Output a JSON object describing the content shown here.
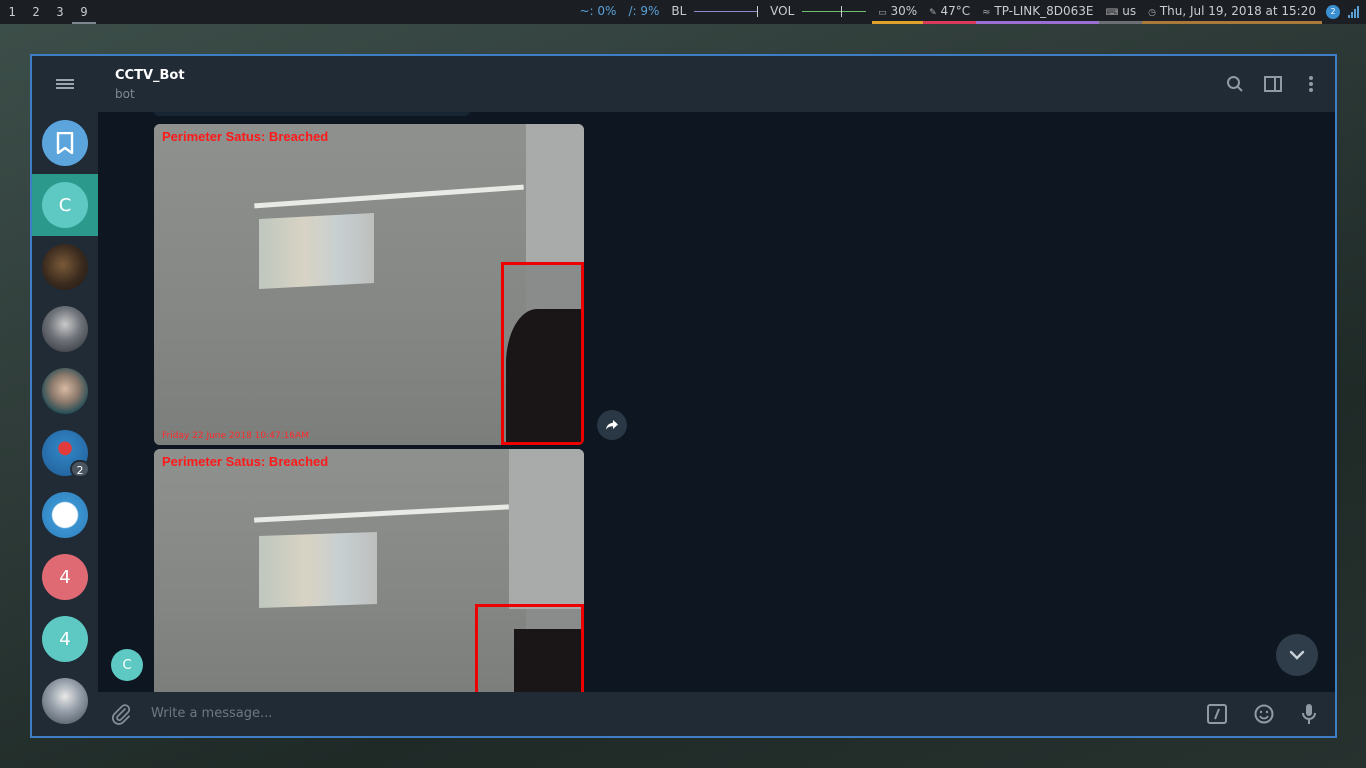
{
  "topbar": {
    "workspaces": [
      {
        "label": "1"
      },
      {
        "label": "2"
      },
      {
        "label": "3"
      },
      {
        "label": "9"
      }
    ],
    "active_workspace": "9",
    "home_usage_label": "~: 0%",
    "root_usage_label": "/: 9%",
    "backlight_label": "BL",
    "backlight_level": 1.0,
    "volume_label": "VOL",
    "volume_level": 0.6,
    "battery_label": "30%",
    "temperature_label": "47°C",
    "wifi_label": "TP-LINK_8D063E",
    "keyboard_layout": "us",
    "datetime": "Thu, Jul 19, 2018 at 15:20",
    "tray_badge": "2"
  },
  "sidebar": {
    "chats": [
      {
        "type": "saved",
        "icon": "bookmark-icon",
        "color": "#5ba4dc"
      },
      {
        "type": "initial",
        "initial": "C",
        "color": "#5ec9c3",
        "active": true
      },
      {
        "type": "photo",
        "color": "#4a3a2c"
      },
      {
        "type": "photo",
        "color": "#51565c"
      },
      {
        "type": "photo",
        "color": "#2f5e66"
      },
      {
        "type": "photo",
        "color": "#2f7fbf",
        "badge": "2"
      },
      {
        "type": "photo",
        "color": "#3a93cf"
      },
      {
        "type": "initial",
        "initial": "4",
        "color": "#e06a74"
      },
      {
        "type": "initial",
        "initial": "4",
        "color": "#5ec9c3"
      },
      {
        "type": "photo",
        "color": "#7f8b9a"
      }
    ]
  },
  "header": {
    "title": "CCTV_Bot",
    "subtitle": "bot"
  },
  "messages": [
    {
      "status_text": "Perimeter Satus: Breached",
      "timestamp_text": "Friday 22 June 2018 10:47:16AM"
    },
    {
      "status_text": "Perimeter Satus: Breached"
    }
  ],
  "chat_avatar_initial": "C",
  "composer": {
    "placeholder": "Write a message..."
  },
  "colors": {
    "accent": "#2b9a8d",
    "window_border": "#3d7ec6",
    "alert_red": "#ff1a1a"
  }
}
